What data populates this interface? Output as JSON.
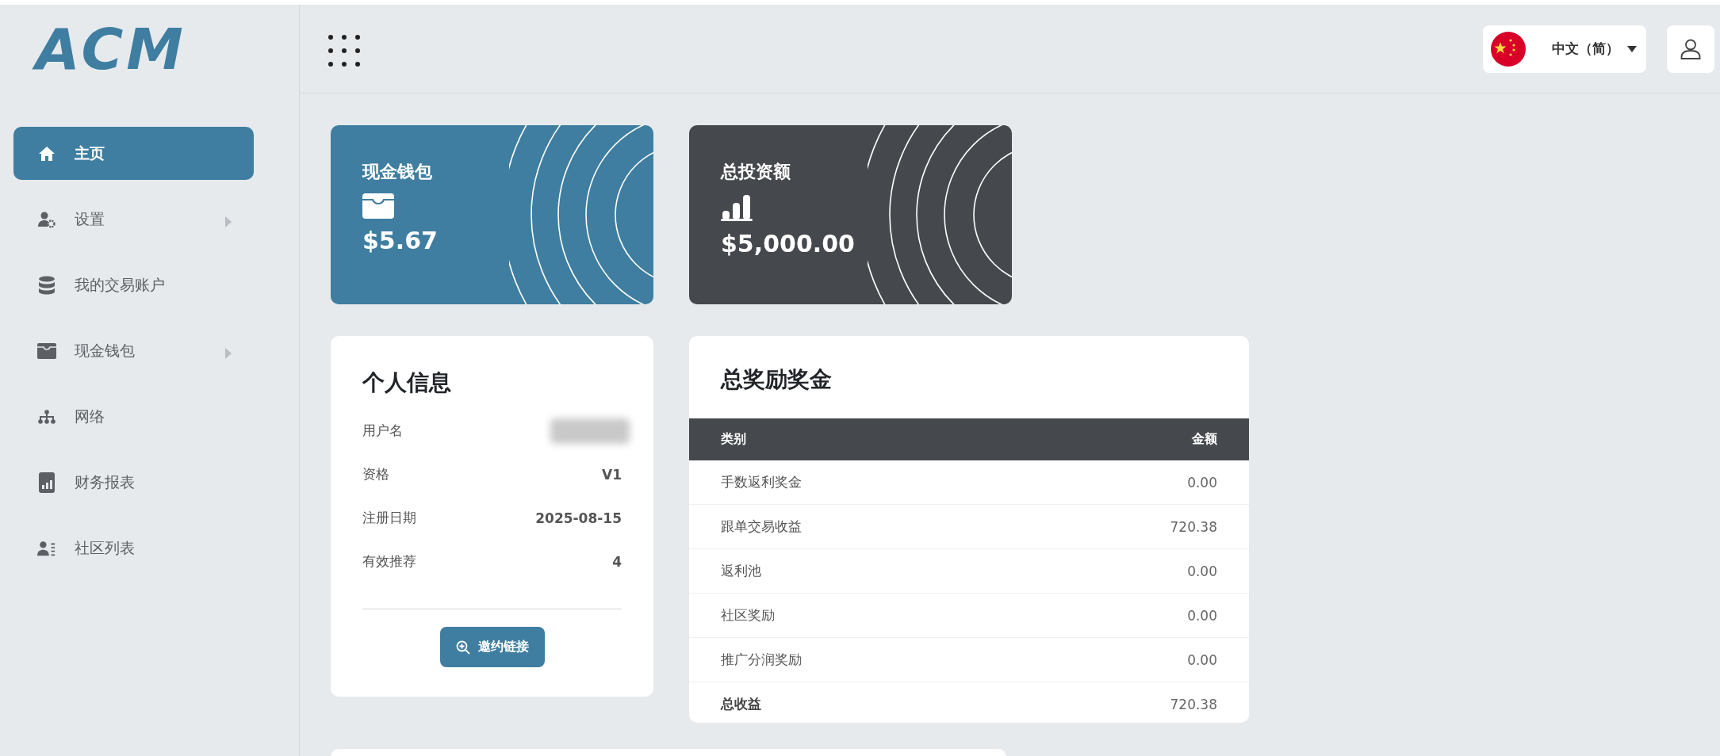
{
  "logo": "ACM",
  "language": {
    "label": "中文（简）"
  },
  "sidebar": {
    "items": [
      {
        "label": "主页",
        "kind": "home",
        "selected": true,
        "has_submenu": false
      },
      {
        "label": "设置",
        "kind": "settings",
        "selected": false,
        "has_submenu": true
      },
      {
        "label": "我的交易账户",
        "kind": "database",
        "selected": false,
        "has_submenu": false
      },
      {
        "label": "现金钱包",
        "kind": "wallet",
        "selected": false,
        "has_submenu": true
      },
      {
        "label": "网络",
        "kind": "network",
        "selected": false,
        "has_submenu": false
      },
      {
        "label": "财务报表",
        "kind": "report",
        "selected": false,
        "has_submenu": false
      },
      {
        "label": "社区列表",
        "kind": "community",
        "selected": false,
        "has_submenu": false
      }
    ]
  },
  "stat_cards": [
    {
      "title": "现金钱包",
      "amount": "$5.67",
      "kind": "wallet"
    },
    {
      "title": "总投资额",
      "amount": "$5,000.00",
      "kind": "invest"
    }
  ],
  "profile": {
    "title": "个人信息",
    "rows": [
      {
        "label": "用户名",
        "redacted": true
      },
      {
        "label": "资格",
        "value": "V1",
        "redacted": false
      },
      {
        "label": "注册日期",
        "value": "2025-08-15",
        "redacted": false
      },
      {
        "label": "有效推荐",
        "value": "4",
        "redacted": false
      }
    ],
    "button": "邀约链接"
  },
  "rewards": {
    "title": "总奖励奖金",
    "columns": [
      "类别",
      "金额"
    ],
    "rows": [
      {
        "category": "手数返利奖金",
        "amount": "0.00",
        "total": false
      },
      {
        "category": "跟单交易收益",
        "amount": "720.38",
        "total": false
      },
      {
        "category": "返利池",
        "amount": "0.00",
        "total": false
      },
      {
        "category": "社区奖励",
        "amount": "0.00",
        "total": false
      },
      {
        "category": "推广分润奖励",
        "amount": "0.00",
        "total": false
      },
      {
        "category": "总收益",
        "amount": "720.38",
        "total": true
      }
    ]
  }
}
